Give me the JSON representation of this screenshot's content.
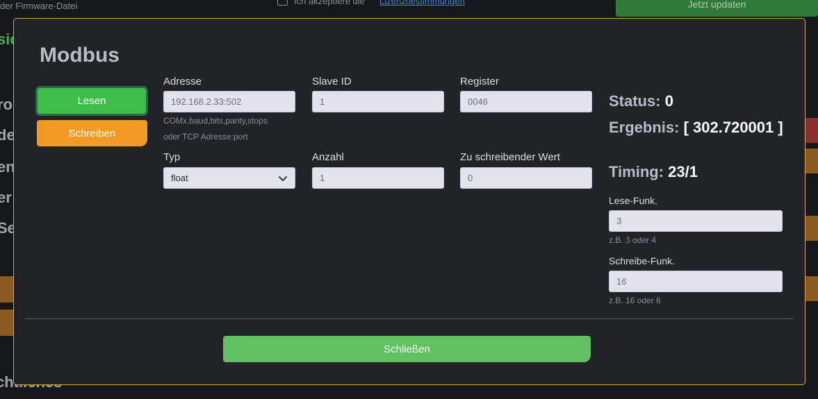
{
  "background": {
    "firmware_text": "der Firmware-Datei",
    "accept_text": "Ich akzeptiere die",
    "accept_link": "Lizenzbestimmungen",
    "update_button": "Jetzt updaten",
    "left_fragments": [
      "sic",
      "ro",
      "de",
      "en",
      "er",
      "Se"
    ],
    "bottom_heading": "chtliches"
  },
  "modal": {
    "title": "Modbus",
    "read_button": "Lesen",
    "write_button": "Schreiben",
    "fields": {
      "address": {
        "label": "Adresse",
        "value": "192.168.2.33:502",
        "hint1": "COMx,baud,bits,parity,stops",
        "hint2": "oder TCP Adresse:port"
      },
      "slave_id": {
        "label": "Slave ID",
        "value": "1"
      },
      "register": {
        "label": "Register",
        "value": "0046"
      },
      "type": {
        "label": "Typ",
        "value": "float"
      },
      "count": {
        "label": "Anzahl",
        "value": "1"
      },
      "write_value": {
        "label": "Zu schreibender Wert",
        "value": "0"
      }
    },
    "results": {
      "status_label": "Status:",
      "status_value": "0",
      "result_label": "Ergebnis:",
      "result_value": "[ 302.720001 ]",
      "timing_label": "Timing:",
      "timing_value": "23/1"
    },
    "read_func": {
      "label": "Lese-Funk.",
      "value": "3",
      "hint": "z.B. 3 oder 4"
    },
    "write_func": {
      "label": "Schreibe-Funk.",
      "value": "16",
      "hint": "z.B. 16 oder 6"
    },
    "close_button": "Schließen"
  },
  "colors": {
    "accent_green": "#3fbd4a",
    "accent_orange": "#f39a23",
    "modal_border": "#e0a34a",
    "close_green": "#5fc160"
  }
}
